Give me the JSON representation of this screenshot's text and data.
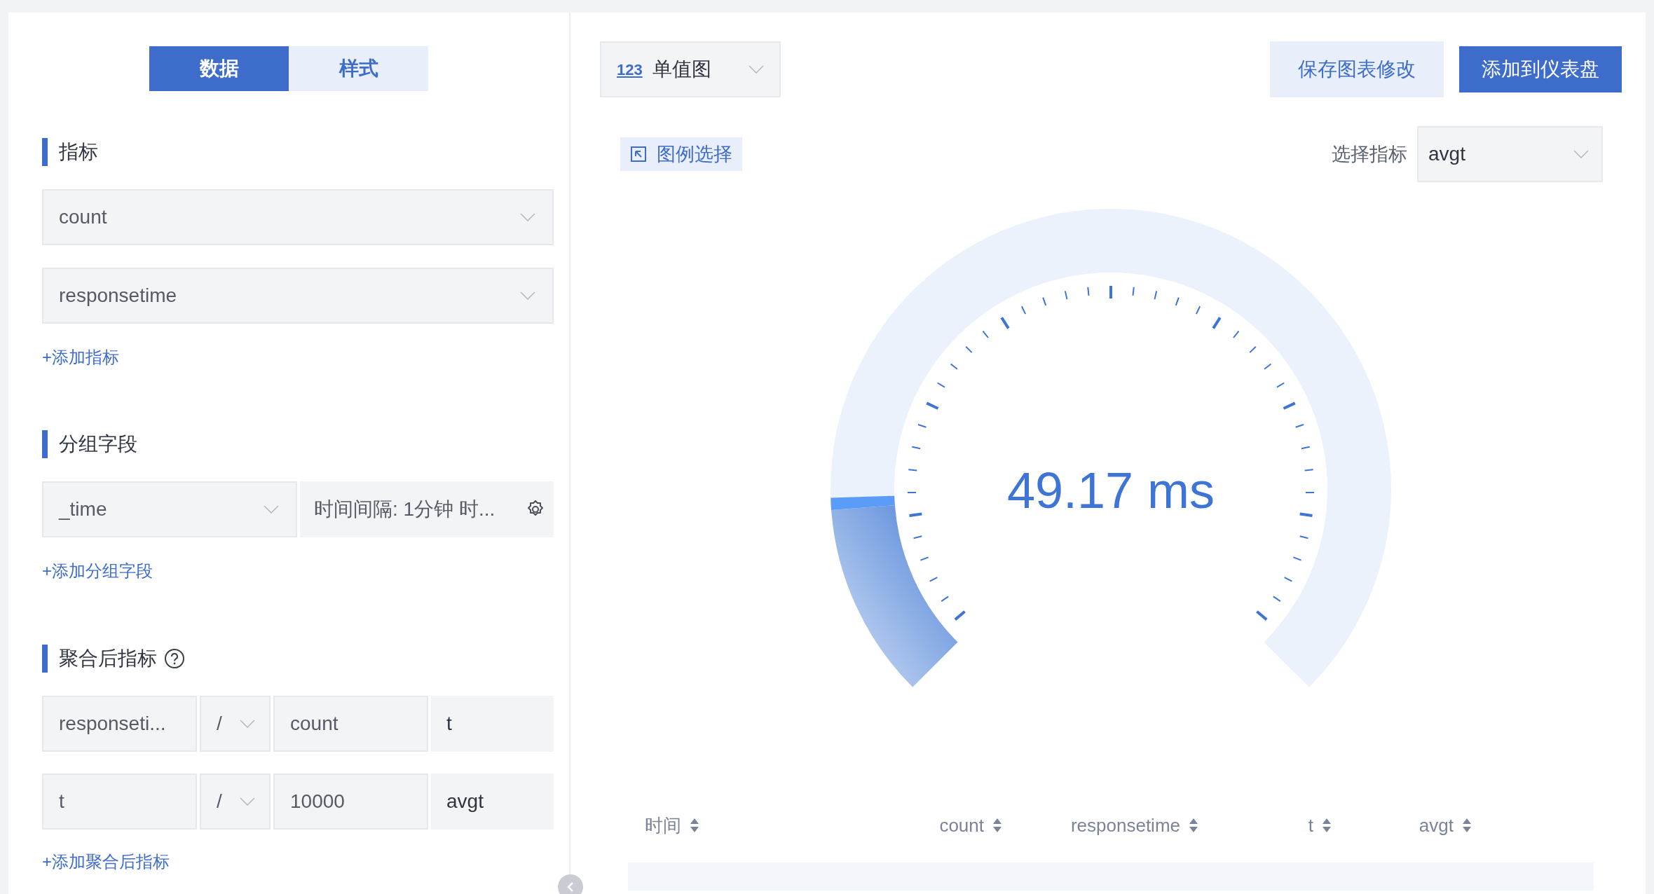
{
  "tabs": [
    {
      "label": "数据",
      "selected": true
    },
    {
      "label": "样式",
      "selected": false
    }
  ],
  "metrics": {
    "title": "指标",
    "selects": [
      "count",
      "responsetime"
    ],
    "add_link": "+添加指标"
  },
  "grouping": {
    "title": "分组字段",
    "field": "_time",
    "interval": "时间间隔: 1分钟 时...",
    "add_link": "+添加分组字段"
  },
  "derived": {
    "title": "聚合后指标",
    "rows": [
      {
        "operand_1": "responseti...",
        "operator": "/",
        "operand_2": "count",
        "result": "t"
      },
      {
        "operand_1": "t",
        "operator": "/",
        "operand_2": "10000",
        "result": "avgt"
      }
    ],
    "add_link": "+添加聚合后指标"
  },
  "chart_type": {
    "icon_text": "123",
    "label": "单值图"
  },
  "buttons": [
    {
      "label": "保存图表修改",
      "kind": "secondary"
    },
    {
      "label": "添加到仪表盘",
      "kind": "primary"
    }
  ],
  "legend_button": "图例选择",
  "metric_picker": {
    "label": "选择指标",
    "value": "avgt"
  },
  "gauge": {
    "value_text": "49.17 ms",
    "level": 0.16
  },
  "table": {
    "columns": [
      "时间",
      "count",
      "responsetime",
      "t",
      "avgt"
    ]
  }
}
